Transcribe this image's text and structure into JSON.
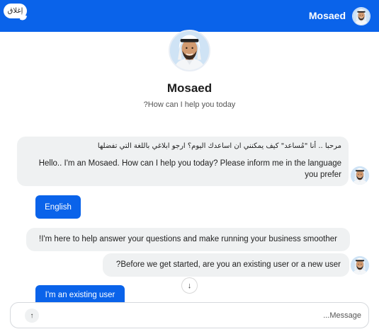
{
  "header": {
    "close_label": "إغلاق",
    "agent_name": "Mosaed"
  },
  "profile": {
    "name": "Mosaed",
    "subtitle": "?How can I help you today"
  },
  "messages": {
    "greeting_ar": "مرحبا .. أنا \"مُساعد\" كيف يمكنني ان اساعدك اليوم؟ ارجو ابلاغي باللغة التي تفضلها",
    "greeting_en": "Hello.. I'm an Mosaed. How can I help you today? Please inform me in the language you prefer",
    "help": "!I'm here to help answer your questions and make running your business smoother",
    "before_start": "?Before we get started, are you an existing user or a new user"
  },
  "choices": {
    "english": "English",
    "existing_user": "I'm an existing user"
  },
  "composer": {
    "placeholder": "...Message",
    "send_icon": "↑"
  },
  "scroll_icon": "↓",
  "colors": {
    "brand": "#0a63ea",
    "bubble": "#eff1f2"
  }
}
